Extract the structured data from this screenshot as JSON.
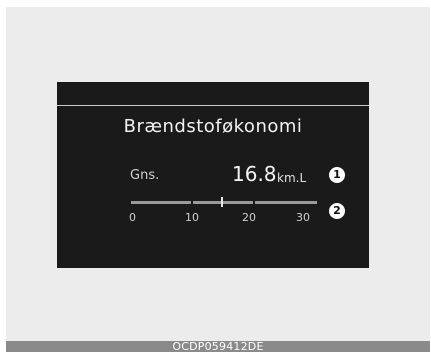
{
  "caption": "OCDP059412DE",
  "display": {
    "title": "Brændstoføkonomi",
    "average_label": "Gns.",
    "average_value": "16.8",
    "average_unit": "km.L",
    "callout_1": "1",
    "callout_2": "2",
    "scale": {
      "ticks": [
        "0",
        "10",
        "20",
        "30"
      ],
      "min": 0,
      "max": 30,
      "marker_value": 16.8
    }
  }
}
